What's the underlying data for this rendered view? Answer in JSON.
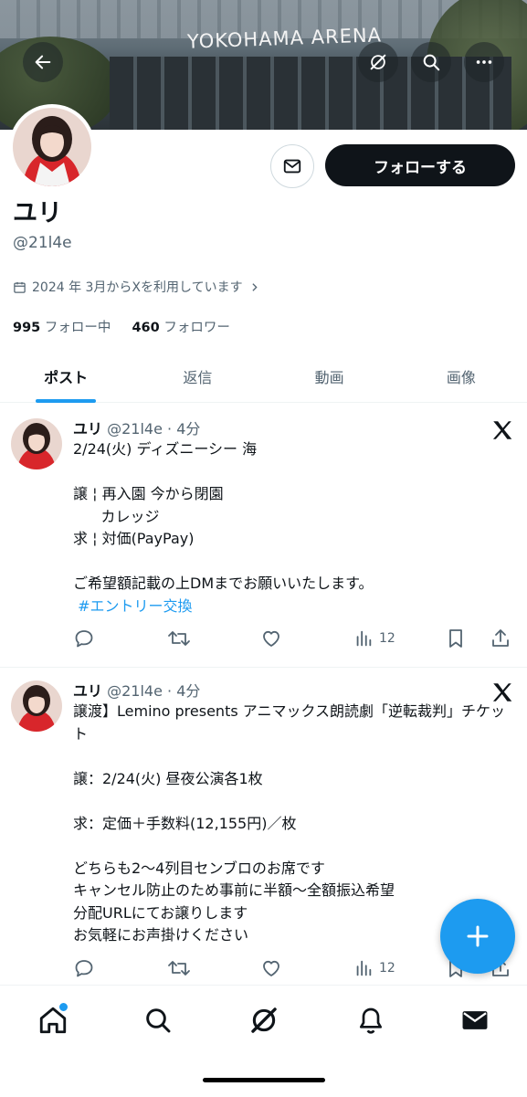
{
  "banner": {
    "venue_text": "YOKOHAMA ARENA"
  },
  "header_actions": {
    "back": "back-arrow-icon",
    "grok": "grok-icon",
    "search": "search-icon",
    "more": "more-icon"
  },
  "profile": {
    "name": "ユリ",
    "handle": "@21l4e",
    "joined": "2024 年 3月からXを利用しています",
    "following_count": "995",
    "following_label": "フォロー中",
    "followers_count": "460",
    "followers_label": "フォロワー",
    "follow_button": "フォローする"
  },
  "tabs": [
    {
      "label": "ポスト",
      "active": true
    },
    {
      "label": "返信",
      "active": false
    },
    {
      "label": "動画",
      "active": false
    },
    {
      "label": "画像",
      "active": false
    }
  ],
  "tweets": [
    {
      "name": "ユリ",
      "meta": "@21l4e · 4分",
      "body": "2/24(火) ディズニーシー 海\n\n譲 ¦ 再入園 今から閉園\n      カレッジ\n求 ¦ 対価(PayPay)\n\nご希望額記載の上DMまでお願いいたします。",
      "hashtag": " #エントリー交換",
      "views": "12"
    },
    {
      "name": "ユリ",
      "meta": "@21l4e · 4分",
      "body": "譲渡】Lemino presents アニマックス朗読劇「逆転裁判」チケット\n\n譲：2/24(火) 昼夜公演各1枚\n\n求：定価＋手数料(12,155円)／枚\n\nどちらも2〜4列目センブロのお席です\nキャンセル防止のため事前に半額〜全額振込希望\n分配URLにてお譲りします\nお気軽にお声掛けください",
      "views": "12"
    }
  ],
  "colors": {
    "accent": "#1d9bf0",
    "text": "#0f1419",
    "muted": "#536471"
  },
  "nav": [
    "home-icon",
    "search-icon",
    "grok-icon",
    "notifications-icon",
    "messages-icon"
  ]
}
